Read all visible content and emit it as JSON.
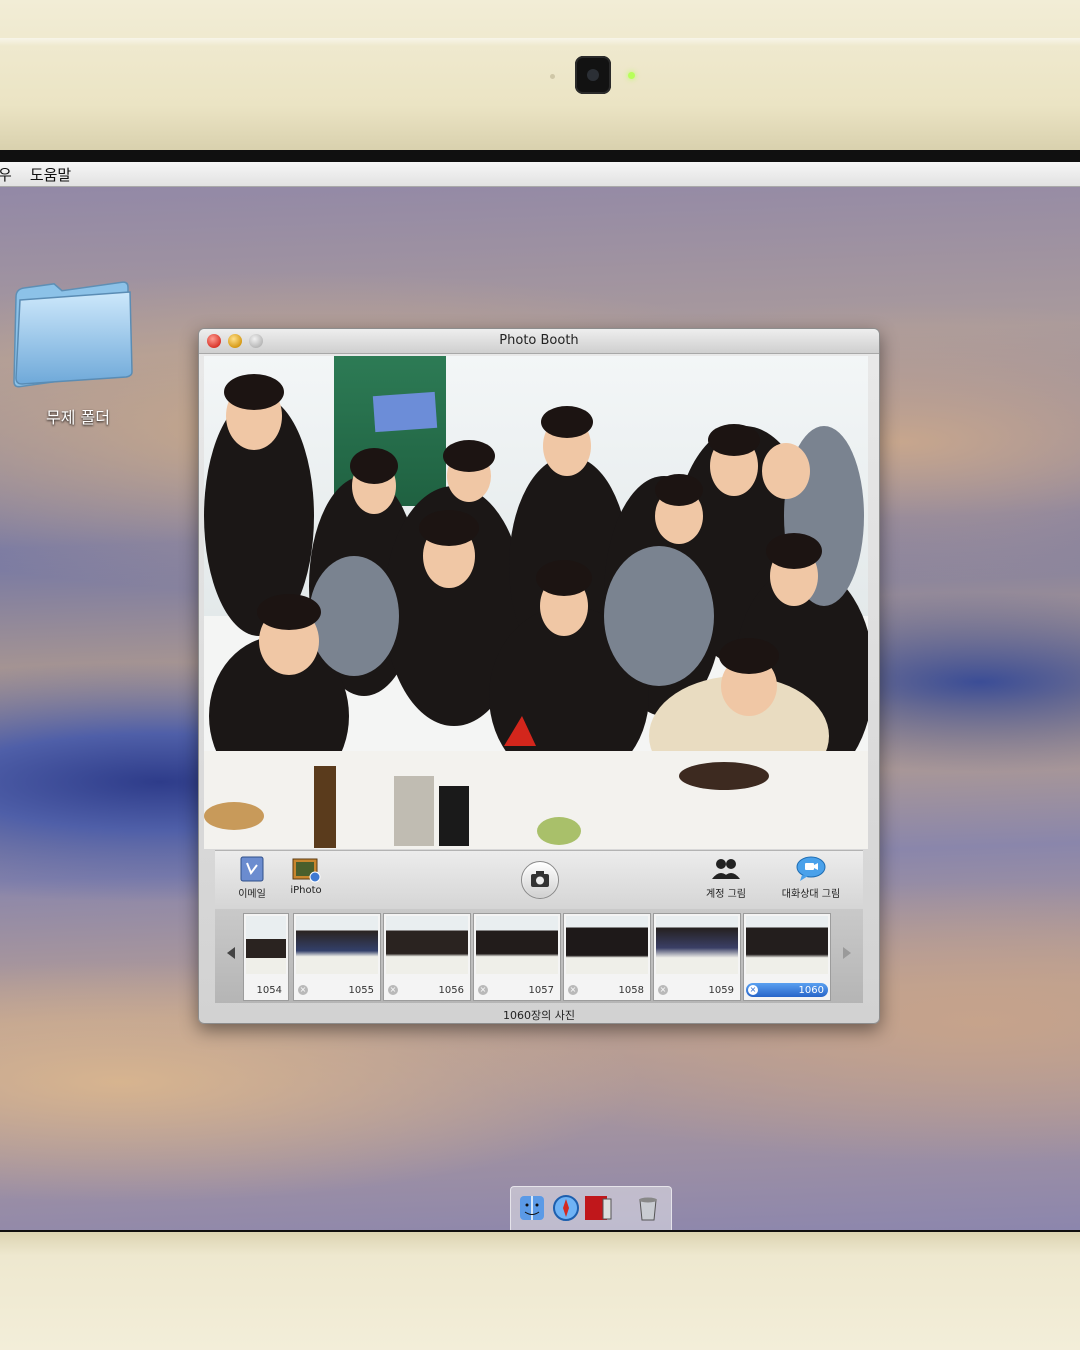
{
  "menubar": {
    "item_partial": "우",
    "help": "도움말"
  },
  "desktop": {
    "folder_label": "무제 폴더"
  },
  "window": {
    "title": "Photo Booth",
    "toolbar": {
      "email_label": "이메일",
      "iphoto_label": "iPhoto",
      "account_picture_label": "계정 그림",
      "buddy_picture_label": "대화상대 그림"
    },
    "thumbnails": [
      {
        "number": "1054"
      },
      {
        "number": "1055"
      },
      {
        "number": "1056"
      },
      {
        "number": "1057"
      },
      {
        "number": "1058"
      },
      {
        "number": "1059"
      },
      {
        "number": "1060",
        "selected": true
      }
    ],
    "status": "1060장의 사진"
  },
  "dock": {
    "items": [
      "finder-icon",
      "safari-icon",
      "photo-booth-icon",
      "trash-icon"
    ]
  },
  "colors": {
    "selection": "#2765c9",
    "close": "#d9362b",
    "minimize": "#d69a16"
  }
}
